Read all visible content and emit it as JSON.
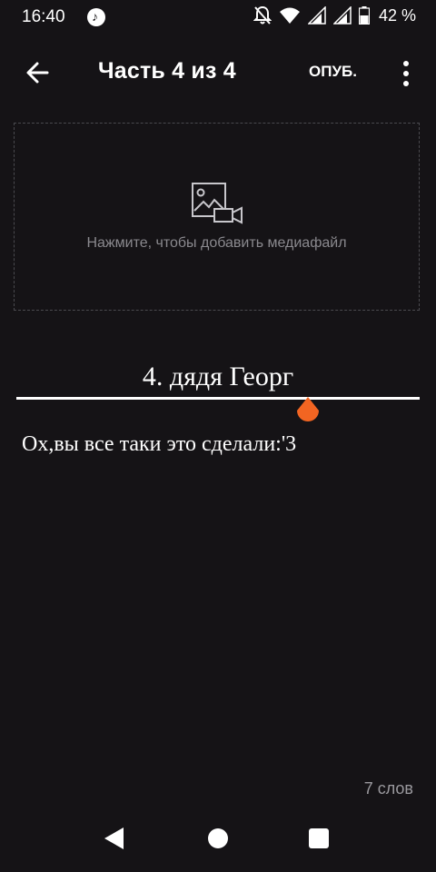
{
  "status_bar": {
    "time": "16:40",
    "battery_percent": "42 %",
    "icons": [
      "tiktok-icon",
      "notifications-off-icon",
      "wifi-icon",
      "signal-icon",
      "signal-icon",
      "battery-icon"
    ]
  },
  "toolbar": {
    "back_icon": "arrow-back-icon",
    "title": "Часть 4 из 4",
    "publish_label": "ОПУБ.",
    "more_icon": "more-vertical-icon"
  },
  "media_area": {
    "icon": "add-media-icon",
    "hint": "Нажмите, чтобы добавить медиафайл"
  },
  "editor": {
    "title": "4. дядя Георг",
    "body": "Ох,вы все таки это сделали:'3",
    "cursor_color": "#F26522"
  },
  "footer": {
    "word_count": "7 слов"
  },
  "nav_bar": {
    "icons": [
      "nav-back-icon",
      "nav-home-icon",
      "nav-recents-icon"
    ]
  }
}
